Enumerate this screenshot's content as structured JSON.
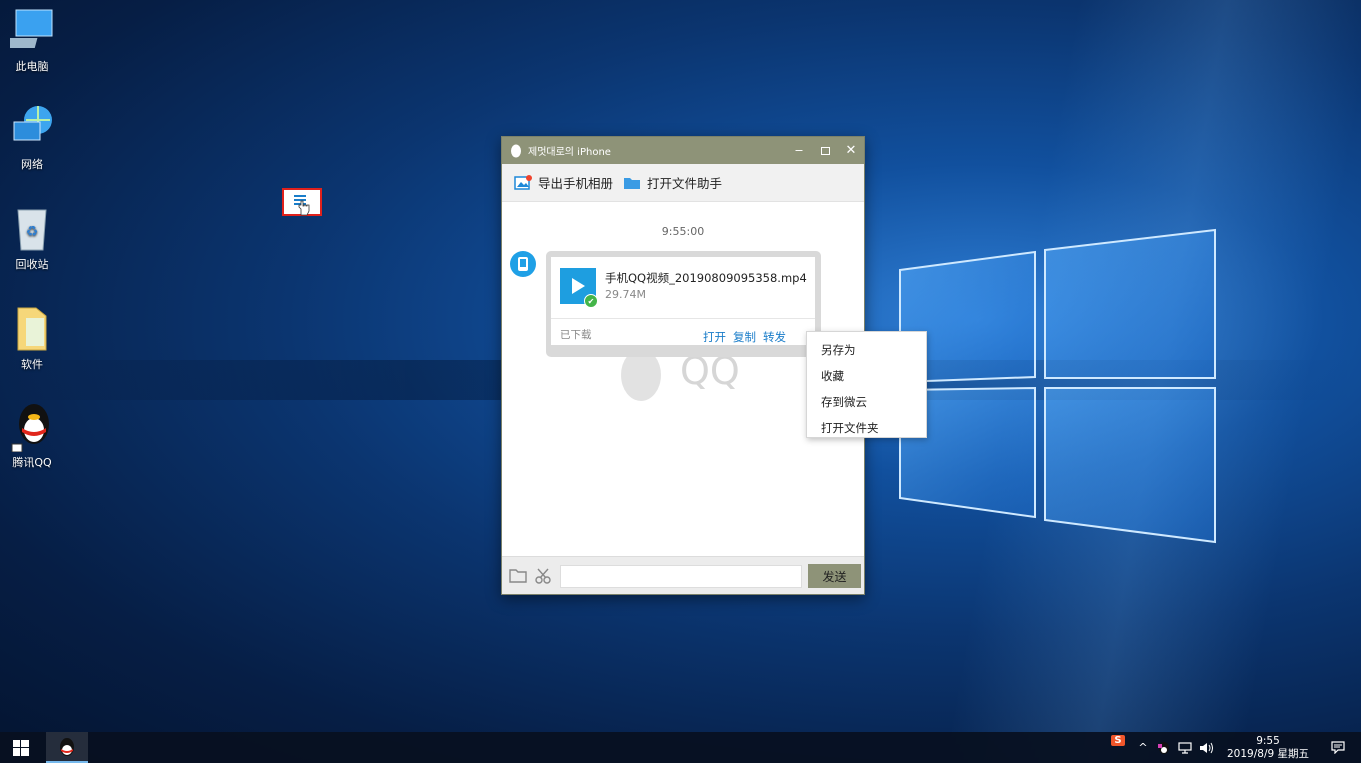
{
  "desktop": {
    "icons": [
      {
        "label": "此电脑",
        "icon": "computer-icon"
      },
      {
        "label": "网络",
        "icon": "network-icon"
      },
      {
        "label": "回收站",
        "icon": "recycle-bin-icon"
      },
      {
        "label": "软件",
        "icon": "folder-icon"
      },
      {
        "label": "腾讯QQ",
        "icon": "qq-penguin-icon"
      }
    ]
  },
  "window": {
    "title": "제멋대로의 iPhone",
    "toolbar": {
      "export_album": "导出手机相册",
      "open_file_helper": "打开文件助手"
    },
    "chat": {
      "timestamp": "9:55:00",
      "file": {
        "name": "手机QQ视频_20190809095358.mp4",
        "size": "29.74M",
        "status": "已下载",
        "actions": {
          "open": "打开",
          "copy": "复制",
          "forward": "转发"
        }
      },
      "watermark": "QQ"
    },
    "input": {
      "send": "发送",
      "value": ""
    }
  },
  "context_menu": {
    "items": [
      "另存为",
      "收藏",
      "存到微云",
      "打开文件夹"
    ]
  },
  "taskbar": {
    "clock_time": "9:55",
    "clock_date": "2019/8/9 星期五",
    "ime_label": "S"
  },
  "colors": {
    "titlebar": "#8e9378",
    "accent_blue": "#1e9ee0",
    "link_blue": "#1a7dc9",
    "highlight_red": "#e0211c"
  }
}
